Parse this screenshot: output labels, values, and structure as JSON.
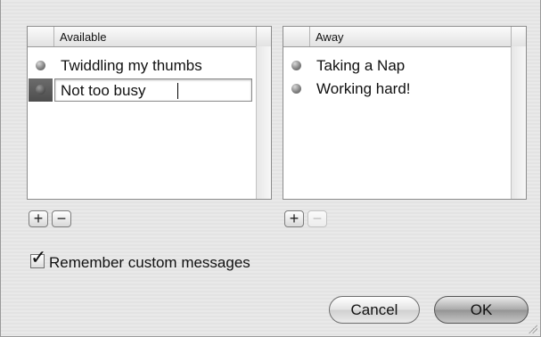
{
  "available": {
    "header": "Available",
    "items": [
      "Twiddling my thumbs"
    ],
    "editing_value": "Not too busy"
  },
  "away": {
    "header": "Away",
    "items": [
      "Taking a Nap",
      "Working hard!"
    ]
  },
  "buttons": {
    "add": "+",
    "remove": "−",
    "cancel": "Cancel",
    "ok": "OK"
  },
  "options": {
    "remember_label": "Remember custom messages",
    "remember_checked": true,
    "check_glyph": "✓"
  },
  "colors": {
    "status_dot": "#7d7d7d",
    "selection": "#5a5a5a"
  }
}
